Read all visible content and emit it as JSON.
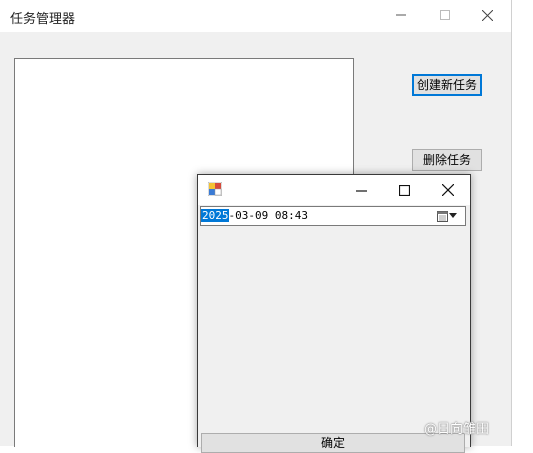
{
  "main_window": {
    "title": "任务管理器",
    "buttons": {
      "create_task": "创建新任务",
      "delete_task": "删除任务"
    },
    "title_controls": [
      "minimize-icon",
      "maximize-icon",
      "close-icon"
    ]
  },
  "dialog": {
    "datetime_year": "2025",
    "datetime_rest": "-03-09 08:43",
    "ok_button": "确定",
    "title_controls": [
      "minimize-icon",
      "maximize-icon",
      "close-icon"
    ]
  },
  "watermark": "@日向雏田",
  "colors": {
    "selection": "#0078d7",
    "window_bg": "#f0f0f0"
  }
}
